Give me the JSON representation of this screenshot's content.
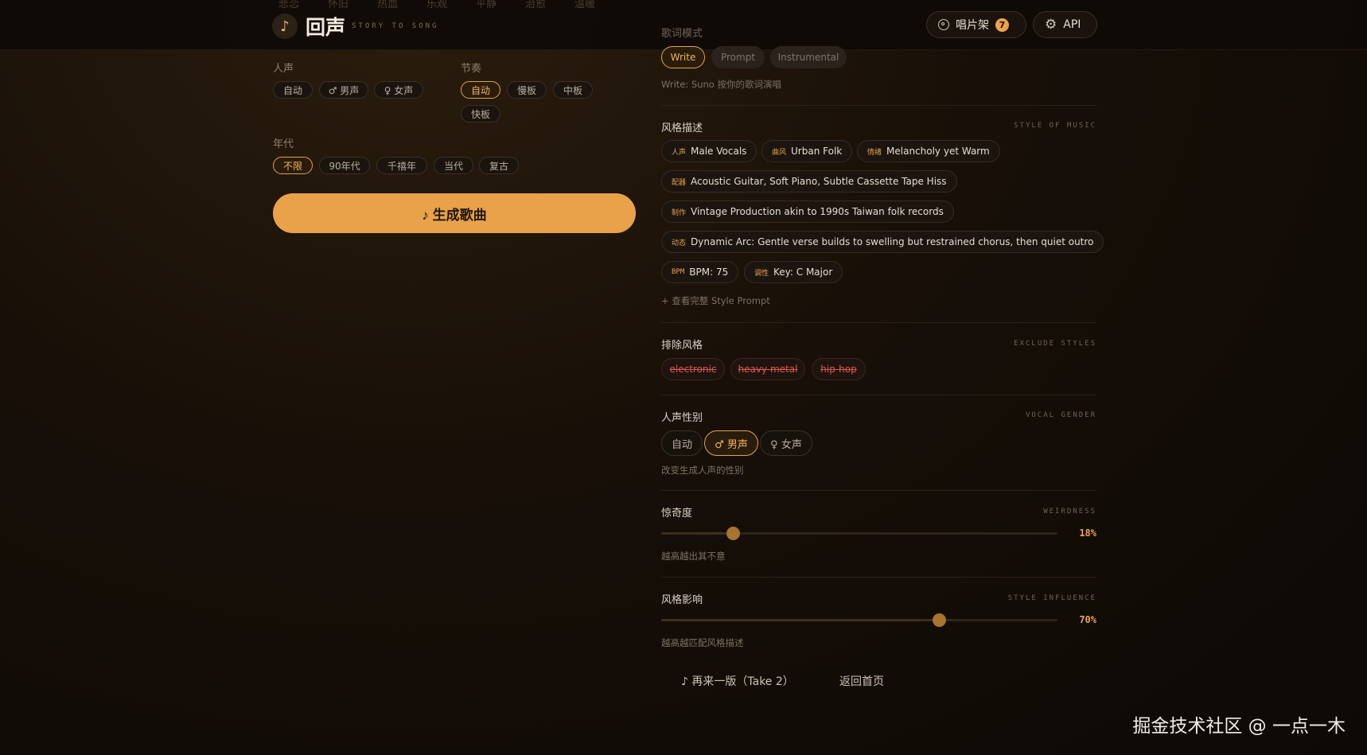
{
  "header": {
    "ghost_tabs": [
      "悲恋",
      "怀旧",
      "热血",
      "乐观",
      "平静",
      "治愈",
      "温暖"
    ],
    "logo_glyph": "♪",
    "app_name": "回声",
    "app_subtitle": "STORY TO SONG",
    "record_shelf_label": "唱片架",
    "record_shelf_count": "7",
    "api_label": "API"
  },
  "left": {
    "vocal": {
      "label": "人声",
      "options": [
        "自动",
        "♂ 男声",
        "♀ 女声"
      ]
    },
    "tempo": {
      "label": "节奏",
      "options": [
        "自动",
        "慢板",
        "中板",
        "快板"
      ],
      "selected": "自动"
    },
    "era": {
      "label": "年代",
      "options": [
        "不限",
        "90年代",
        "千禧年",
        "当代",
        "复古"
      ],
      "selected": "不限"
    },
    "generate_label": "♪ 生成歌曲"
  },
  "right": {
    "lyrics_mode": {
      "title": "歌词模式",
      "options": [
        "Write",
        "Prompt",
        "Instrumental"
      ],
      "selected": "Write",
      "hint": "Write: Suno 按你的歌词演唱"
    },
    "style": {
      "title": "风格描述",
      "title_en": "STYLE OF MUSIC",
      "tags": [
        {
          "cat": "人声",
          "text": "Male Vocals"
        },
        {
          "cat": "曲风",
          "text": "Urban Folk"
        },
        {
          "cat": "情绪",
          "text": "Melancholy yet Warm"
        },
        {
          "cat": "配器",
          "text": "Acoustic Guitar, Soft Piano, Subtle Cassette Tape Hiss"
        },
        {
          "cat": "制作",
          "text": "Vintage Production akin to 1990s Taiwan folk records"
        },
        {
          "cat": "动态",
          "text": "Dynamic Arc: Gentle verse builds to swelling but restrained chorus, then quiet outro"
        },
        {
          "cat": "BPM",
          "text": "BPM: 75"
        },
        {
          "cat": "调性",
          "text": "Key: C Major"
        }
      ],
      "view_full": "+ 查看完整 Style Prompt"
    },
    "exclude": {
      "title": "排除风格",
      "title_en": "EXCLUDE STYLES",
      "items": [
        "electronic",
        "heavy metal",
        "hip-hop"
      ]
    },
    "vocal_gender": {
      "title": "人声性别",
      "title_en": "VOCAL GENDER",
      "options": [
        "自动",
        "♂ 男声",
        "♀ 女声"
      ],
      "selected": "♂ 男声",
      "hint": "改变生成人声的性别"
    },
    "weirdness": {
      "title": "惊奇度",
      "title_en": "WEIRDNESS",
      "value": 18,
      "value_text": "18%",
      "hint": "越高越出其不意"
    },
    "style_influence": {
      "title": "风格影响",
      "title_en": "STYLE INFLUENCE",
      "value": 70,
      "value_text": "70%",
      "hint": "越高越匹配风格描述"
    },
    "retry_label": "♪ 再来一版（Take 2）",
    "home_label": "返回首页"
  },
  "watermark": "掘金技术社区 @ 一点一木",
  "colors": {
    "accent": "#e9a24a",
    "exclude": "#d9574b",
    "background": "#0d0905"
  }
}
